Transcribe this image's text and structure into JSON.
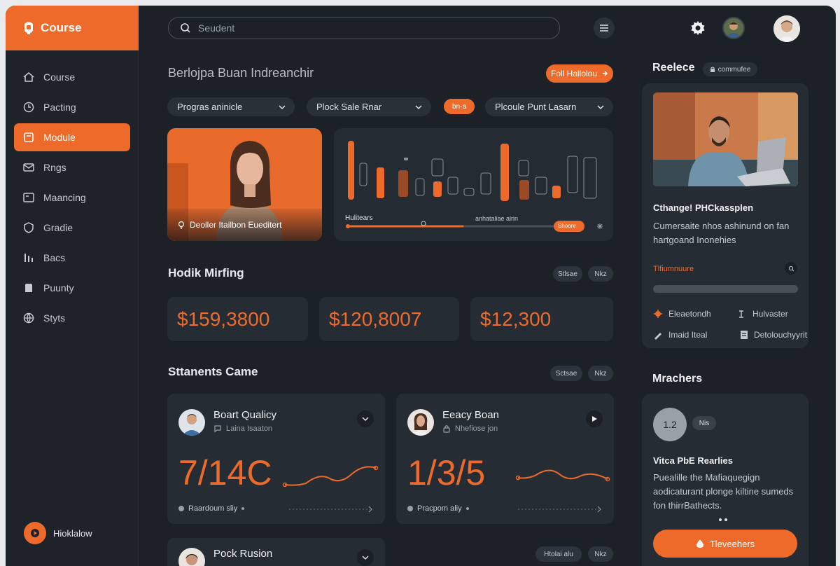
{
  "brand": {
    "name": "Course"
  },
  "sidebar": {
    "items": [
      {
        "label": "Course",
        "icon": "home-icon"
      },
      {
        "label": "Pacting",
        "icon": "clock-icon"
      },
      {
        "label": "Module",
        "icon": "folder-icon",
        "active": true
      },
      {
        "label": "Rngs",
        "icon": "mail-icon"
      },
      {
        "label": "Maancing",
        "icon": "card-icon"
      },
      {
        "label": "Gradie",
        "icon": "shield-icon"
      },
      {
        "label": "Bacs",
        "icon": "bars-icon"
      },
      {
        "label": "Puunty",
        "icon": "tag-icon"
      },
      {
        "label": "Styts",
        "icon": "globe-icon"
      }
    ],
    "footer_label": "Hioklalow"
  },
  "search": {
    "placeholder": "Seudent"
  },
  "main": {
    "title": "Berlojpa Buan Indreanchir",
    "follow_label": "Foll Hallolou",
    "filters": [
      {
        "label": "Progras aninicle"
      },
      {
        "label": "Plock Sale Rnar"
      },
      {
        "label": "Plcoule Punt Lasarn"
      }
    ],
    "filter_chip": "bn-a",
    "hero_caption": "Deoller Itailbon Eueditert",
    "chart": {
      "legend_label": "Hulitears",
      "slider_caption": "anhataliae alrin",
      "slider_button": "Shoore"
    },
    "stats_title": "Hodik Mirfing",
    "stats_pills": [
      "Stlsae",
      "Nkz"
    ],
    "stats": [
      "$159,3800",
      "$120,8007",
      "$12,300"
    ],
    "students_title": "Sttanents Came",
    "students_pills": [
      "Sctsae",
      "Nkz"
    ],
    "students": [
      {
        "name": "Boart Qualicy",
        "sub": "Laina Isaaton",
        "value": "7/14C",
        "footer": "Raardoum sliy"
      },
      {
        "name": "Eeacy Boan",
        "sub": "Nhefiose jon",
        "value": "1/3/5",
        "footer": "Pracpom aliy"
      }
    ],
    "peek_student": "Pock Rusion",
    "peek_pills": [
      "Htolai alu",
      "Nkz"
    ]
  },
  "right": {
    "title": "Reelece",
    "chip": "commufee",
    "card": {
      "heading": "Cthange! PHCkassplen",
      "desc": "Cumersaite nhos ashinund on fan hartgoand Inonehies",
      "label": "Tlfiumnuure",
      "meta": [
        {
          "label": "Eleaetondh",
          "icon": "flame-icon"
        },
        {
          "label": "Hulvaster",
          "icon": "hammer-icon"
        },
        {
          "label": "Imaid Iteal",
          "icon": "pen-icon"
        },
        {
          "label": "Detolouchyyrit",
          "icon": "doc-icon"
        }
      ]
    },
    "mentors_title": "Mrachers",
    "mentor": {
      "circle": "1.2",
      "chip": "Nis",
      "heading": "Vitca PbE Rearlies",
      "desc": "Puealille the Mafiaquegign aodicaturant plonge kiltine sumeds fon thirrBathects.",
      "button": "Tleveehers"
    }
  },
  "colors": {
    "accent": "#ee6a2a",
    "bg": "#1c2128",
    "card": "#262c34"
  }
}
